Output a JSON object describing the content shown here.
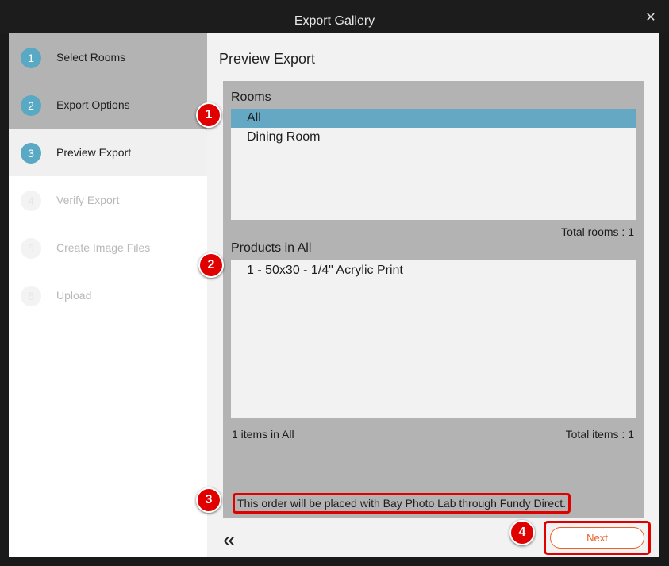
{
  "window": {
    "title": "Export Gallery",
    "close_icon": "close-icon"
  },
  "sidebar": {
    "steps": [
      {
        "number": "1",
        "label": "Select Rooms",
        "state": "done"
      },
      {
        "number": "2",
        "label": "Export Options",
        "state": "done"
      },
      {
        "number": "3",
        "label": "Preview Export",
        "state": "active"
      },
      {
        "number": "4",
        "label": "Verify Export",
        "state": "future"
      },
      {
        "number": "5",
        "label": "Create Image Files",
        "state": "future"
      },
      {
        "number": "6",
        "label": "Upload",
        "state": "future"
      }
    ]
  },
  "main": {
    "title": "Preview Export",
    "rooms": {
      "label": "Rooms",
      "items": [
        "All",
        "Dining Room"
      ],
      "selected": "All",
      "total": "Total rooms : 1"
    },
    "products": {
      "label": "Products in All",
      "items": [
        "1 - 50x30 - 1/4\" Acrylic Print"
      ],
      "count": "1 items in All",
      "total": "Total items : 1"
    },
    "notice": "This order will be placed with Bay Photo Lab through Fundy Direct.",
    "back_icon": "double-chevron-left-icon",
    "next_label": "Next"
  },
  "callouts": [
    "1",
    "2",
    "3",
    "4"
  ],
  "colors": {
    "accent": "#5aa9c4",
    "highlight": "#e00000",
    "next": "#e8622a"
  }
}
